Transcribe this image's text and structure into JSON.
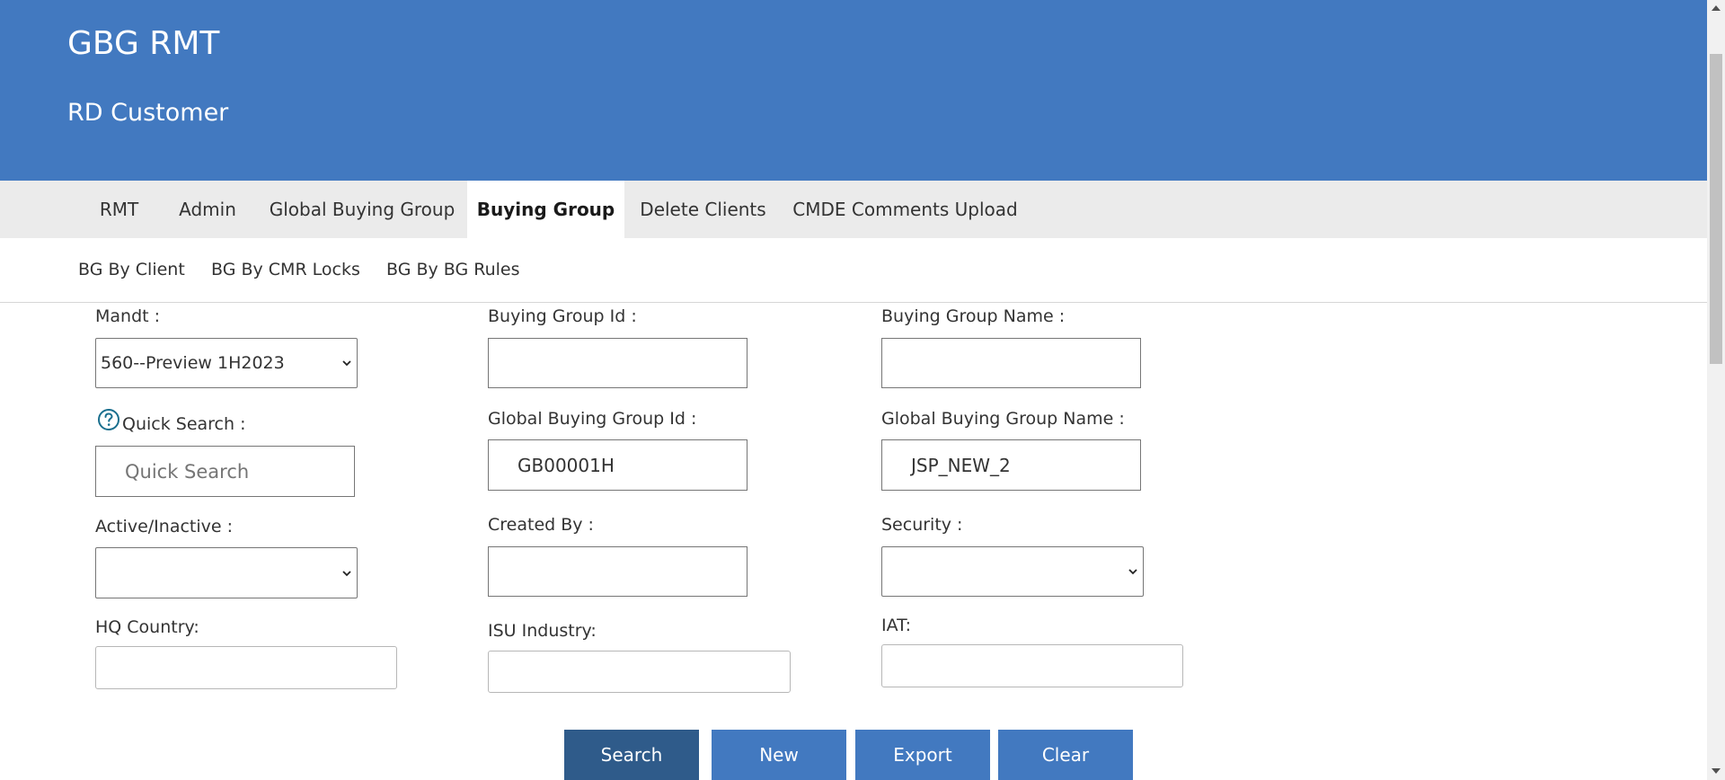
{
  "header": {
    "app_title": "GBG RMT",
    "sub_title": "RD Customer"
  },
  "tabs": [
    "RMT",
    "Admin",
    "Global Buying Group",
    "Buying Group",
    "Delete Clients",
    "CMDE Comments Upload"
  ],
  "active_tab": "Buying Group",
  "subnav": [
    "BG By Client",
    "BG By CMR Locks",
    "BG By BG Rules"
  ],
  "form": {
    "mandt": {
      "label": "Mandt :",
      "value": "560--Preview 1H2023"
    },
    "quick_search": {
      "label": "Quick Search :",
      "placeholder": "Quick Search"
    },
    "active_inactive": {
      "label": "Active/Inactive :",
      "value": ""
    },
    "hq_country": {
      "label": "HQ Country:",
      "value": ""
    },
    "buying_group_id": {
      "label": "Buying Group Id :",
      "value": ""
    },
    "global_buying_group_id": {
      "label": "Global Buying Group Id :",
      "value": "GB00001H"
    },
    "created_by": {
      "label": "Created By :",
      "value": ""
    },
    "isu_industry": {
      "label": "ISU Industry:",
      "value": ""
    },
    "buying_group_name": {
      "label": "Buying Group Name :",
      "value": ""
    },
    "global_buying_group_name": {
      "label": "Global Buying Group Name :",
      "value": "JSP_NEW_2"
    },
    "security": {
      "label": "Security :",
      "value": ""
    },
    "iat": {
      "label": "IAT:",
      "value": ""
    }
  },
  "buttons": {
    "search": "Search",
    "new": "New",
    "export": "Export",
    "clear": "Clear"
  },
  "colors": {
    "header_bg": "#4279c0",
    "tabbar_bg": "#ebebeb",
    "primary_button": "#4279c0",
    "search_button": "#2f5b8a",
    "help_icon": "#1a6f8e"
  },
  "icons": {
    "help": "question-circle-icon",
    "select_arrow": "chevron-down-icon"
  }
}
